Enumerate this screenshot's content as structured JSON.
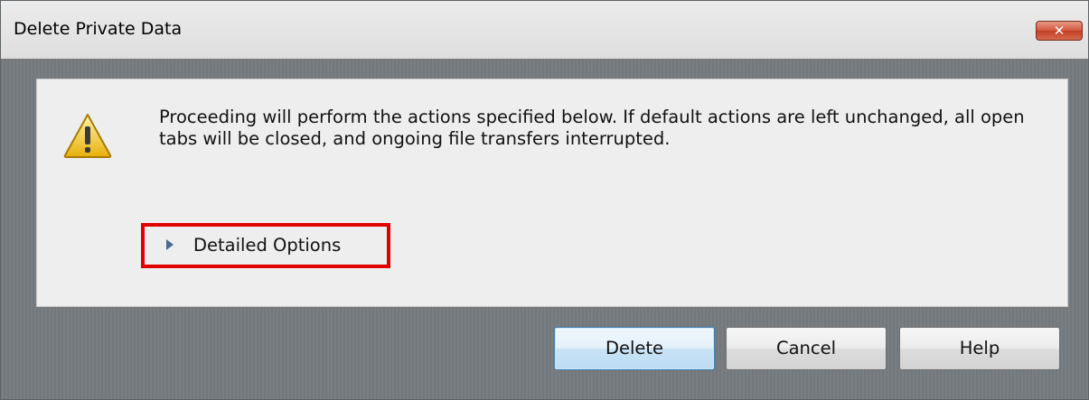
{
  "window": {
    "title": "Delete Private Data",
    "close_glyph": "✕"
  },
  "message": "Proceeding will perform the actions specified below. If default actions are left unchanged, all open tabs will be closed, and ongoing file transfers interrupted.",
  "icons": {
    "warning": "warning-icon",
    "expander": "triangle-right-icon"
  },
  "expander": {
    "label": "Detailed Options",
    "expanded": false
  },
  "buttons": {
    "delete": "Delete",
    "cancel": "Cancel",
    "help": "Help"
  },
  "colors": {
    "highlight": "#e00000",
    "close_button": "#c94a30",
    "default_button_border": "#3c7fb1"
  }
}
